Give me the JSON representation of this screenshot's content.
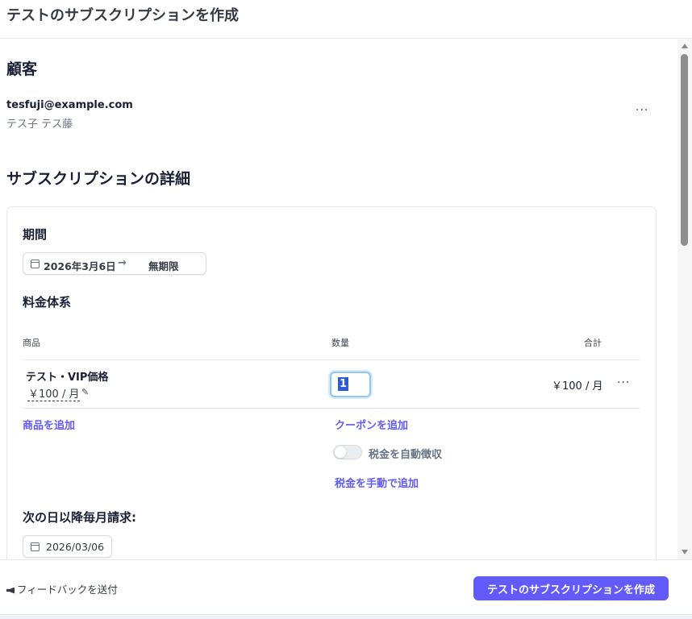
{
  "header": {
    "title": "テストのサブスクリプションを作成"
  },
  "customer": {
    "section_title": "顧客",
    "email": "tesfuji@example.com",
    "name": "テス子 テス藤",
    "more": "···"
  },
  "details": {
    "section_title": "サブスクリプションの詳細",
    "period": {
      "label": "期間",
      "start": "2026年3月6日",
      "arrow": "→",
      "end": "無期限"
    },
    "pricing": {
      "label": "料金体系",
      "columns": {
        "product": "商品",
        "quantity": "数量",
        "total": "合計"
      },
      "items": [
        {
          "name": "テスト・VIP価格",
          "price": "￥100 / 月",
          "quantity": "1",
          "total": "￥100 / 月",
          "more": "···"
        }
      ],
      "add_product": "商品を追加",
      "add_coupon": "クーポンを追加",
      "auto_tax_label": "税金を自動徴収",
      "auto_tax_enabled": false,
      "manual_tax": "税金を手動で追加"
    },
    "billing": {
      "label": "次の日以降毎月請求:",
      "date": "2026/03/06"
    }
  },
  "footer": {
    "feedback": "フィードバックを送付",
    "submit": "テストのサブスクリプションを作成"
  },
  "colors": {
    "accent": "#625afa",
    "text": "#1a1f36",
    "muted": "#687385"
  }
}
